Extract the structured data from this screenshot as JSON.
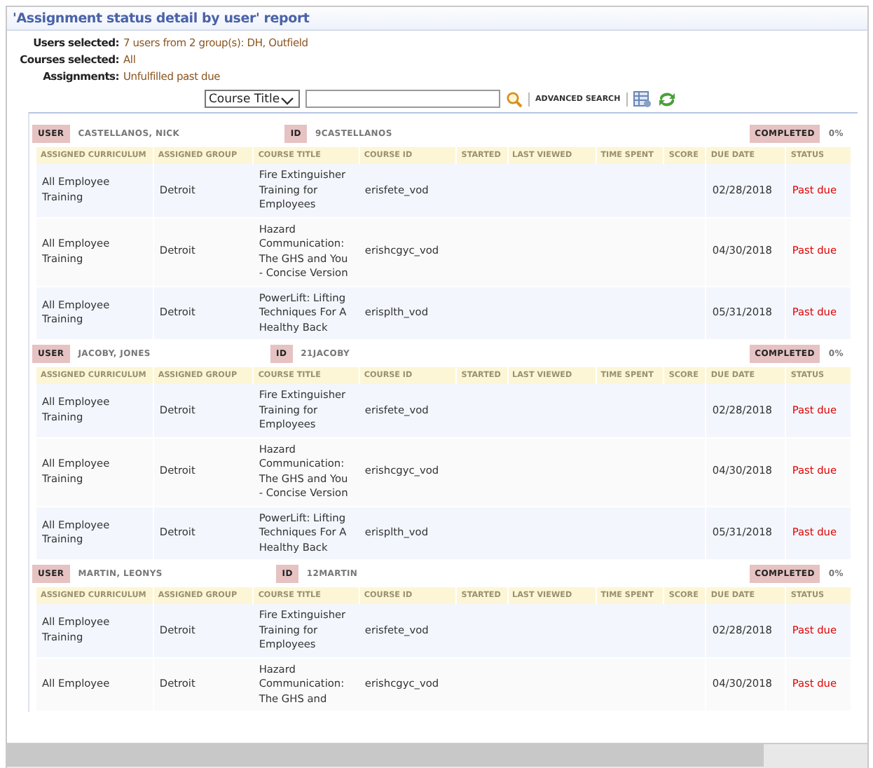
{
  "window": {
    "title": "'Assignment status detail by user' report"
  },
  "filters": [
    {
      "label": "Users selected:",
      "value": "7 users from 2 group(s): DH, Outfield"
    },
    {
      "label": "Courses selected:",
      "value": "All"
    },
    {
      "label": "Assignments:",
      "value": "Unfulfilled past due"
    }
  ],
  "search": {
    "select_value": "Course Title",
    "advanced_search": "ADVANCED SEARCH"
  },
  "users": [
    {
      "user_label": "USER",
      "name": "CASTELLANOS, NICK",
      "id_label": "ID",
      "id": "9CASTELLANOS",
      "completed_label": "COMPLETED",
      "completed": "0%",
      "columns": [
        "ASSIGNED CURRICULUM",
        "ASSIGNED GROUP",
        "COURSE TITLE",
        "COURSE ID",
        "STARTED",
        "LAST VIEWED",
        "TIME SPENT",
        "SCORE",
        "DUE DATE",
        "STATUS"
      ],
      "rows": [
        {
          "curriculum": "All Employee Training",
          "group": "Detroit",
          "title": "Fire Extinguisher Training for Employees",
          "course_id": "erisfete_vod",
          "due_date": "02/28/2018",
          "status": "Past due"
        },
        {
          "curriculum": "All Employee Training",
          "group": "Detroit",
          "title": "Hazard Communication: The GHS and You - Concise Version",
          "course_id": "erishcgyc_vod",
          "due_date": "04/30/2018",
          "status": "Past due"
        },
        {
          "curriculum": "All Employee Training",
          "group": "Detroit",
          "title": "PowerLift: Lifting Techniques For A Healthy Back",
          "course_id": "erisplth_vod",
          "due_date": "05/31/2018",
          "status": "Past due"
        }
      ]
    },
    {
      "user_label": "USER",
      "name": "JACOBY, JONES",
      "id_label": "ID",
      "id": "21JACOBY",
      "completed_label": "COMPLETED",
      "completed": "0%",
      "columns": [
        "ASSIGNED CURRICULUM",
        "ASSIGNED GROUP",
        "COURSE TITLE",
        "COURSE ID",
        "STARTED",
        "LAST VIEWED",
        "TIME SPENT",
        "SCORE",
        "DUE DATE",
        "STATUS"
      ],
      "rows": [
        {
          "curriculum": "All Employee Training",
          "group": "Detroit",
          "title": "Fire Extinguisher Training for Employees",
          "course_id": "erisfete_vod",
          "due_date": "02/28/2018",
          "status": "Past due"
        },
        {
          "curriculum": "All Employee Training",
          "group": "Detroit",
          "title": "Hazard Communication: The GHS and You - Concise Version",
          "course_id": "erishcgyc_vod",
          "due_date": "04/30/2018",
          "status": "Past due"
        },
        {
          "curriculum": "All Employee Training",
          "group": "Detroit",
          "title": "PowerLift: Lifting Techniques For A Healthy Back",
          "course_id": "erisplth_vod",
          "due_date": "05/31/2018",
          "status": "Past due"
        }
      ]
    },
    {
      "user_label": "USER",
      "name": "MARTIN, LEONYS",
      "id_label": "ID",
      "id": "12MARTIN",
      "completed_label": "COMPLETED",
      "completed": "0%",
      "columns": [
        "ASSIGNED CURRICULUM",
        "ASSIGNED GROUP",
        "COURSE TITLE",
        "COURSE ID",
        "STARTED",
        "LAST VIEWED",
        "TIME SPENT",
        "SCORE",
        "DUE DATE",
        "STATUS"
      ],
      "rows": [
        {
          "curriculum": "All Employee Training",
          "group": "Detroit",
          "title": "Fire Extinguisher Training for Employees",
          "course_id": "erisfete_vod",
          "due_date": "02/28/2018",
          "status": "Past due"
        },
        {
          "curriculum": "All Employee",
          "group": "Detroit",
          "title": "Hazard Communication: The GHS and",
          "course_id": "erishcgyc_vod",
          "due_date": "04/30/2018",
          "status": "Past due"
        }
      ]
    }
  ]
}
